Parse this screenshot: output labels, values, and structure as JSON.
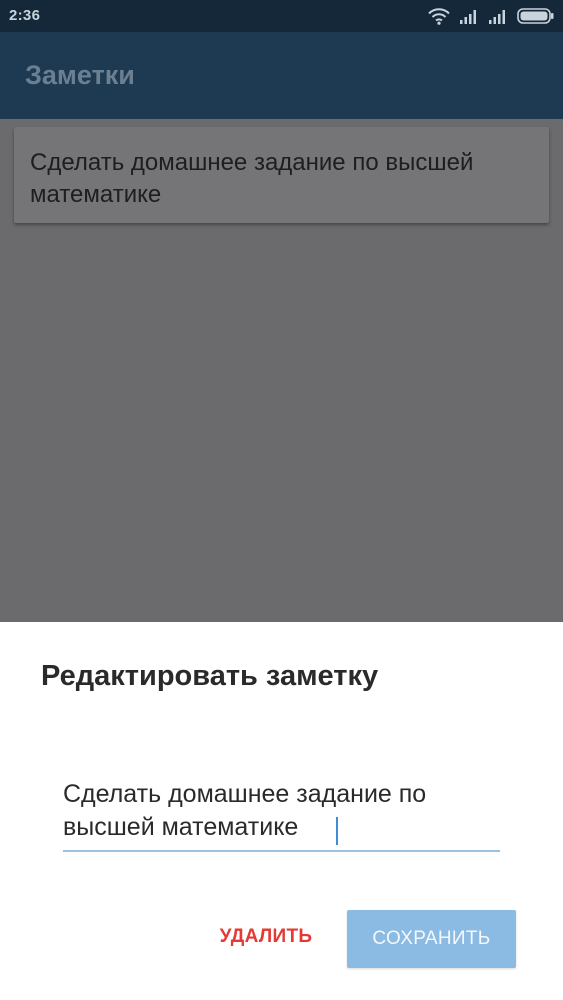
{
  "status_bar": {
    "time": "2:36",
    "icons": [
      "wifi-icon",
      "signal-icon",
      "signal-icon",
      "battery-icon"
    ]
  },
  "app_bar": {
    "title": "Заметки"
  },
  "notes": [
    {
      "text": "Сделать домашнее задание по высшей математике"
    }
  ],
  "dialog": {
    "title": "Редактировать заметку",
    "input_value": "Сделать домашнее задание по высшей математике",
    "delete_label": "УДАЛИТЬ",
    "save_label": "СОХРАНИТЬ"
  },
  "colors": {
    "status_bar": "#14283a",
    "app_bar": "#1d3a52",
    "scrim_content": "#6b6b6d",
    "delete_text": "#e53935",
    "save_button": "#8bbbe3",
    "input_underline": "#9bc3df"
  }
}
